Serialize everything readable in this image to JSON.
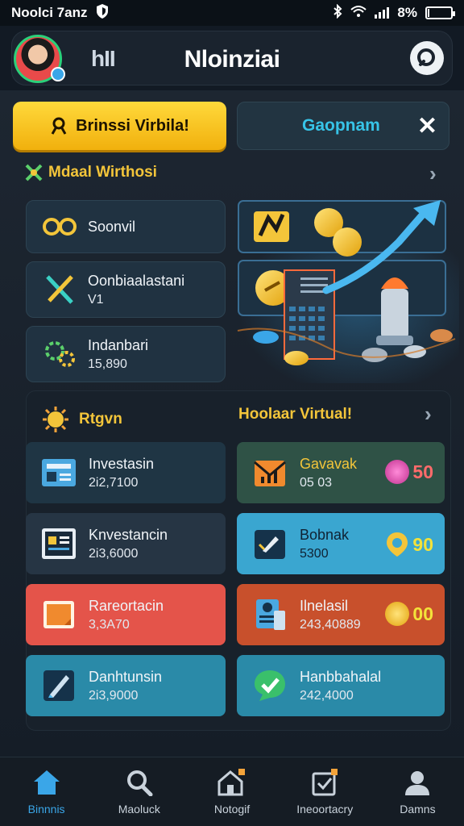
{
  "status_bar": {
    "time": "Noolci 7anz",
    "battery": "8%",
    "battery_level": 0.08
  },
  "header": {
    "logo": "hII",
    "title": "Nloinziai"
  },
  "actions": {
    "primary_label": "Brinssi Virbila!",
    "secondary_label": "Gaopnam"
  },
  "section1": {
    "title": "Mdaal Wirthosi",
    "cards": [
      {
        "label": "Soonvil",
        "sub": ""
      },
      {
        "label": "Oonbiaalastani",
        "sub": "V1"
      },
      {
        "label": "Indanbari",
        "sub": "15,890"
      }
    ]
  },
  "section2": {
    "title_left": "Rtgvn",
    "title_right": "Hoolaar Virtual!",
    "tiles": [
      {
        "label": "Investasin",
        "sub": "2i2,7100"
      },
      {
        "label": "Gavavak",
        "sub": "05 03",
        "value": "50"
      },
      {
        "label": "Knvestancin",
        "sub": "2i3,6000"
      },
      {
        "label": "Bobnak",
        "sub": "5300",
        "value": "90"
      },
      {
        "label": "Rareortacin",
        "sub": "3,3A70"
      },
      {
        "label": "Ilnelasil",
        "sub": "243,40889",
        "value": "00"
      },
      {
        "label": "Danhtunsin",
        "sub": "2i3,9000"
      },
      {
        "label": "Hanbbahalal",
        "sub": "242,4000"
      }
    ]
  },
  "nav": [
    {
      "label": "Binnnis",
      "icon": "home-icon",
      "active": true
    },
    {
      "label": "Maoluck",
      "icon": "search-icon"
    },
    {
      "label": "Notogif",
      "icon": "house-badge-icon"
    },
    {
      "label": "Ineoortacry",
      "icon": "clipboard-icon"
    },
    {
      "label": "Damns",
      "icon": "profile-icon"
    }
  ],
  "colors": {
    "accent_yellow": "#f3c53a",
    "accent_blue": "#3aa6e8",
    "bg": "#121a24"
  }
}
